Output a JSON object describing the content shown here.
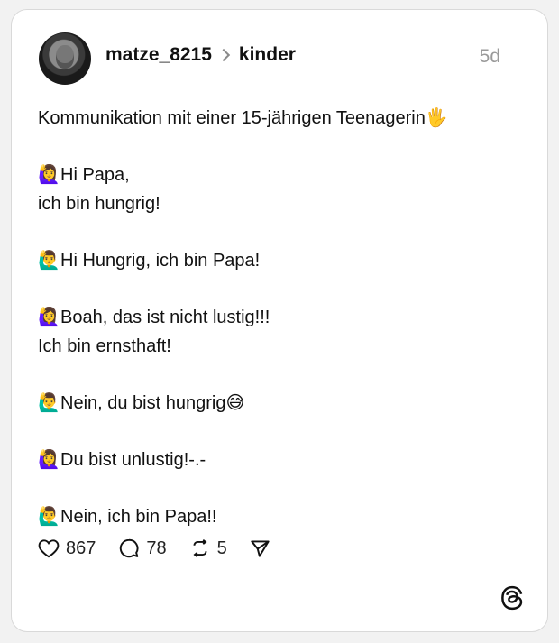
{
  "post": {
    "username": "matze_8215",
    "topic": "kinder",
    "time": "5d",
    "lines": [
      {
        "emoji": "",
        "text": "Kommunikation mit einer 15-jährigen Teenagerin🖐"
      },
      {
        "emoji": "",
        "text": ""
      },
      {
        "emoji": "🙋‍♀️",
        "text": "Hi Papa,"
      },
      {
        "emoji": "",
        "text": "ich bin hungrig!"
      },
      {
        "emoji": "",
        "text": ""
      },
      {
        "emoji": "🙋‍♂️",
        "text": "Hi Hungrig, ich bin Papa!"
      },
      {
        "emoji": "",
        "text": ""
      },
      {
        "emoji": "🙋‍♀️",
        "text": "Boah, das ist nicht lustig!!!"
      },
      {
        "emoji": "",
        "text": "Ich bin ernsthaft!"
      },
      {
        "emoji": "",
        "text": ""
      },
      {
        "emoji": "🙋‍♂️",
        "text": "Nein, du bist hungrig😅"
      },
      {
        "emoji": "",
        "text": ""
      },
      {
        "emoji": "🙋‍♀️",
        "text": "Du bist unlustig!-.-"
      },
      {
        "emoji": "",
        "text": ""
      },
      {
        "emoji": "🙋‍♂️",
        "text": "Nein, ich bin Papa!!"
      }
    ],
    "likes": "867",
    "comments": "78",
    "reposts": "5"
  }
}
